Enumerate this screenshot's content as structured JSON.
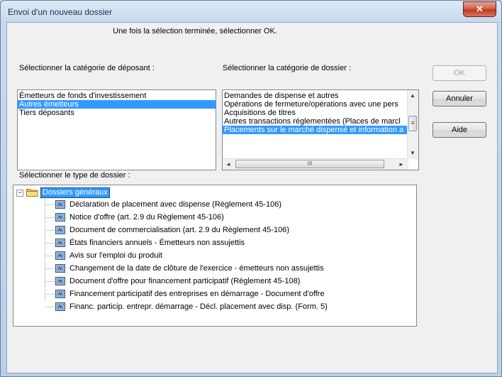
{
  "window": {
    "title": "Envoi d'un nouveau dossier",
    "close_glyph": "✕"
  },
  "instruction": "Une fois la sélection terminée, sélectionner OK.",
  "depositor": {
    "label": "Sélectionner la catégorie de déposant :",
    "items": [
      "Émetteurs de fonds d'investissement",
      "Autres émetteurs",
      "Tiers déposants"
    ],
    "selected_index": 1
  },
  "category": {
    "label": "Sélectionner la catégorie de dossier :",
    "items": [
      "Demandes de dispense et autres",
      "Opérations de fermeture/opérations avec une pers",
      "Acquisitions de titres",
      "Autres transactions réglementées (Places de marcl",
      "Placements sur le marché dispensé et information a"
    ],
    "selected_index": 4
  },
  "buttons": {
    "ok": "OK",
    "cancel": "Annuler",
    "help": "Aide"
  },
  "type": {
    "label": "Sélectionner le type de dossier :",
    "root": "Dossiers généraux",
    "expander": "−",
    "children": [
      "Déclaration de placement avec dispense (Règlement 45-106)",
      "Notice d'offre (art. 2.9 du Règlement 45-106)",
      "Document de commercialisation (art. 2.9 du Règlement 45-106)",
      "États financiers annuels - Émetteurs non assujettis",
      "Avis sur l'emploi du produit",
      "Changement de la date de clôture de l'exercice - émetteurs non assujettis",
      "Document d'offre pour financement participatif (Règlement 45-108)",
      "Financement participatif des entreprises en démarrage - Document d'offre",
      "Financ. particip. entrepr. démarrage - Décl. placement avec disp. (Form. 5)"
    ]
  },
  "scroll": {
    "up": "▲",
    "down": "▼",
    "left": "◄",
    "right": "►",
    "grip": "III",
    "grip_v": "≡"
  },
  "colors": {
    "selection": "#3399ff",
    "titlebar": "#c6daf0",
    "close": "#c0391f"
  }
}
